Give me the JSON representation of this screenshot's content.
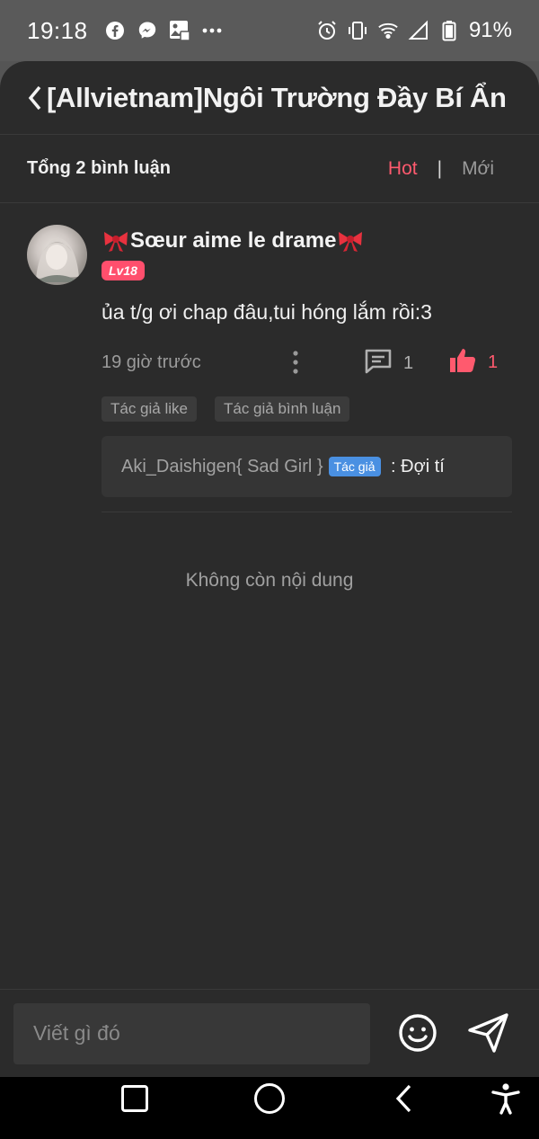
{
  "status_bar": {
    "time": "19:18",
    "battery": "91%",
    "left_icons": [
      "facebook-icon",
      "messenger-icon",
      "photo-notification-icon",
      "more-dots-icon"
    ],
    "right_icons": [
      "alarm-icon",
      "vibrate-icon",
      "wifi-icon",
      "signal-icon",
      "battery-icon"
    ]
  },
  "header": {
    "title": "[Allvietnam]Ngôi Trường Đầy Bí Ẩn",
    "back_icon": "back-chevron-icon"
  },
  "comments_bar": {
    "total_label": "Tổng 2 bình luận",
    "sort_hot": "Hot",
    "separator": "|",
    "sort_new": "Mới",
    "active_color": "#ff5a6e"
  },
  "comment": {
    "username": "Sœur aime le drame",
    "level": "Lv18",
    "text": "ủa t/g ơi chap đâu,tui hóng lắm rồi:3",
    "time": "19 giờ trước",
    "reply_count": "1",
    "like_count": "1",
    "tags": [
      "Tác giả like",
      "Tác giả bình luận"
    ],
    "reply": {
      "author": "Aki_Daishigen{ Sad Girl }",
      "badge": "Tác giả",
      "separator": " : ",
      "text": "Đợi tí"
    }
  },
  "end_message": "Không còn nội dung",
  "input": {
    "placeholder": "Viết gì đó"
  },
  "colors": {
    "accent": "#ff5a6e",
    "author_badge": "#4a90e2",
    "background": "#2b2b2b"
  }
}
